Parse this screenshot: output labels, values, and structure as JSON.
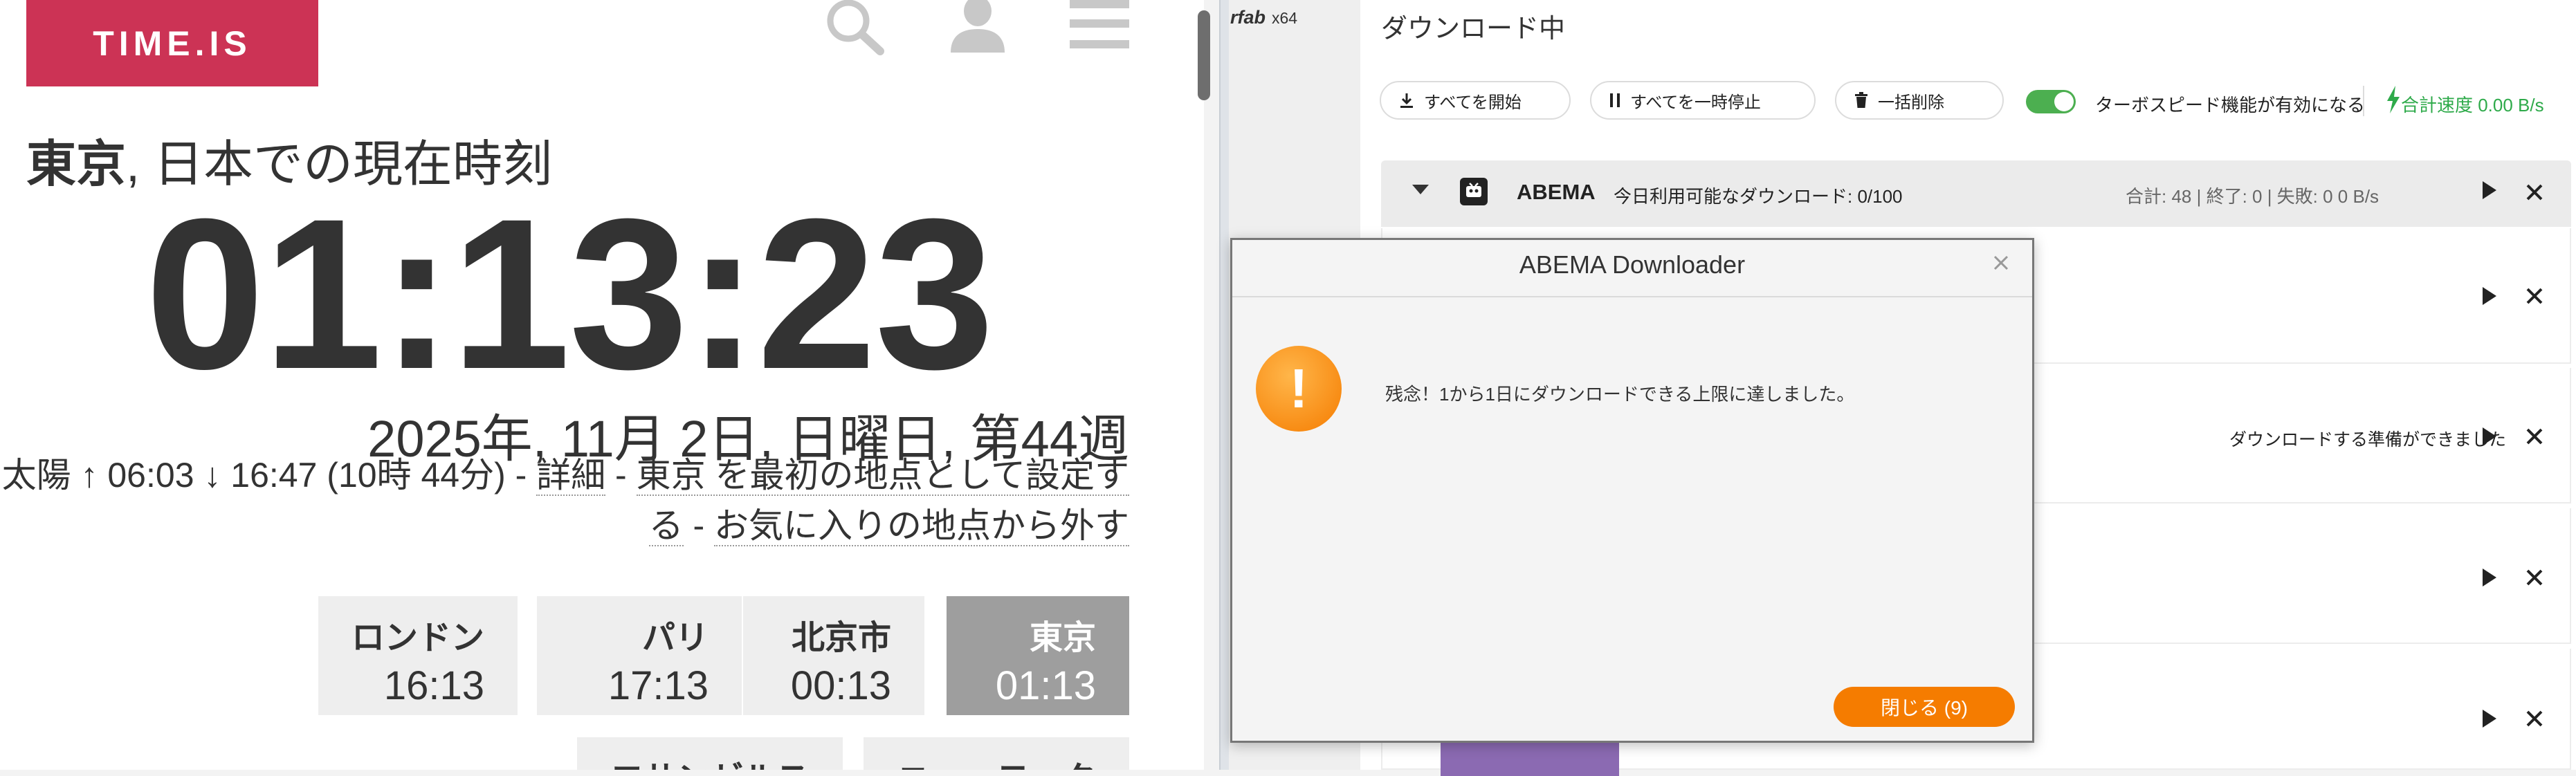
{
  "timeis": {
    "logo": "TIME.IS",
    "headline_city": "東京",
    "headline_rest": ", 日本での現在時刻",
    "clock": "01:13:23",
    "date": "2025年, 11月 2日, 日曜日, 第44週",
    "sun_prefix": "太陽 ↑ 06:03 ↓ 16:47 (10時 44分) - ",
    "link_details": "詳細",
    "sep1": " - ",
    "link_set_first_a": "東京 を最初の地点として設定す",
    "link_set_first_b": "る",
    "sep2": " - ",
    "link_remove_fav": "お気に入りの地点から外す",
    "tiles": [
      {
        "city": "ロンドン",
        "time": "16:13"
      },
      {
        "city": "パリ",
        "time": "17:13"
      },
      {
        "city": "北京市",
        "time": "00:13"
      },
      {
        "city": "東京",
        "time": "01:13"
      }
    ],
    "tiles_row2": [
      {
        "city": "ロサンゼルス"
      },
      {
        "city": "ニューヨーク"
      }
    ]
  },
  "app": {
    "sidebar_logo": "rfab",
    "sidebar_arch": "x64",
    "title": "ダウンロード中",
    "toolbar": {
      "start_all": "すべてを開始",
      "pause_all": "すべてを一時停止",
      "delete_all": "一括削除",
      "turbo_label": "ターボスピード機能が有効になる",
      "total_speed": "合計速度 0.00 B/s"
    },
    "group": {
      "name": "ABEMA",
      "quota": "今日利用可能なダウンロード: 0/100",
      "stats": "合計: 48  |  終了: 0  |  失敗: 0     0 B/s"
    },
    "rows": [
      {
        "status": ""
      },
      {
        "status": "ダウンロードする準備ができました"
      },
      {
        "status": ""
      },
      {
        "status": ""
      }
    ]
  },
  "dialog": {
    "title": "ABEMA Downloader",
    "message": "残念！1から1日にダウンロードできる上限に達しました。",
    "ok_label": "閉じる (9)"
  },
  "colors": {
    "brand": "#cc3355",
    "accent_orange": "#f57c00",
    "accent_green": "#4caf50"
  }
}
